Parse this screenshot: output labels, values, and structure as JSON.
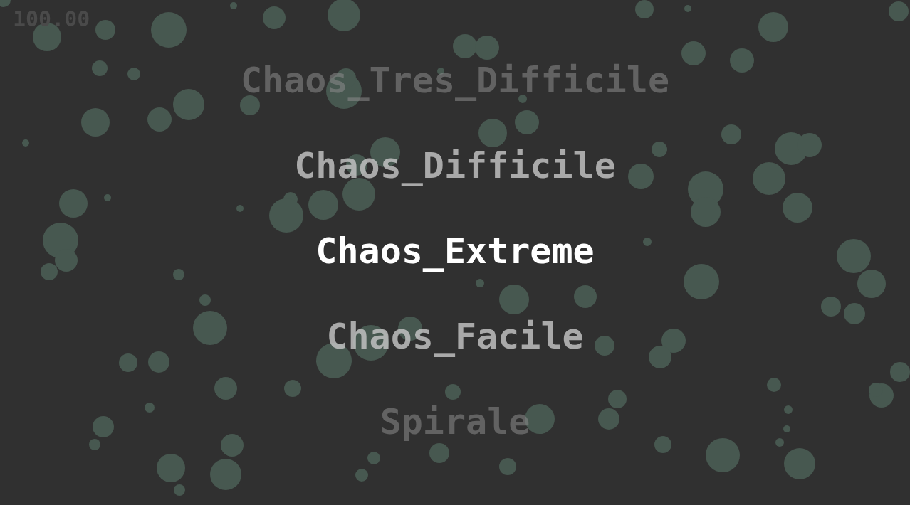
{
  "score": "100.00",
  "menu": [
    {
      "label": "Chaos_Tres_Difficile",
      "selected": false
    },
    {
      "label": "Chaos_Difficile",
      "selected": false
    },
    {
      "label": "Chaos_Extreme",
      "selected": true
    },
    {
      "label": "Chaos_Facile",
      "selected": false
    },
    {
      "label": "Spirale",
      "selected": false
    }
  ]
}
